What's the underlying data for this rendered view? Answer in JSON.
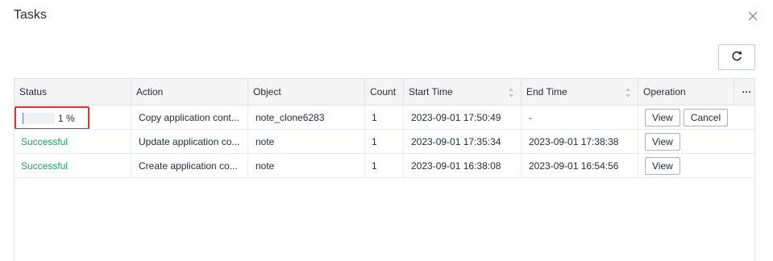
{
  "dialog": {
    "title": "Tasks"
  },
  "icons": {
    "close": "close-icon",
    "refresh": "refresh-icon",
    "more": "more-icon",
    "sort": "sort-icon"
  },
  "colors": {
    "success": "#18a658",
    "highlight_border": "#e0332c"
  },
  "table": {
    "columns": {
      "status": "Status",
      "action": "Action",
      "object": "Object",
      "count": "Count",
      "start_time": "Start Time",
      "end_time": "End Time",
      "operation": "Operation",
      "more": "···"
    },
    "rows": [
      {
        "status_progress": 0.01,
        "status_text": "1 %",
        "action": "Copy application cont...",
        "object": "note_clone6283",
        "count": "1",
        "start_time": "2023-09-01 17:50:49",
        "end_time": "-",
        "view_label": "View",
        "cancel_label": "Cancel"
      },
      {
        "status_text": "Successful",
        "action": "Update application co...",
        "object": "note",
        "count": "1",
        "start_time": "2023-09-01 17:35:34",
        "end_time": "2023-09-01 17:38:38",
        "view_label": "View"
      },
      {
        "status_text": "Successful",
        "action": "Create application co...",
        "object": "note",
        "count": "1",
        "start_time": "2023-09-01 16:38:08",
        "end_time": "2023-09-01 16:54:56",
        "view_label": "View"
      }
    ]
  }
}
